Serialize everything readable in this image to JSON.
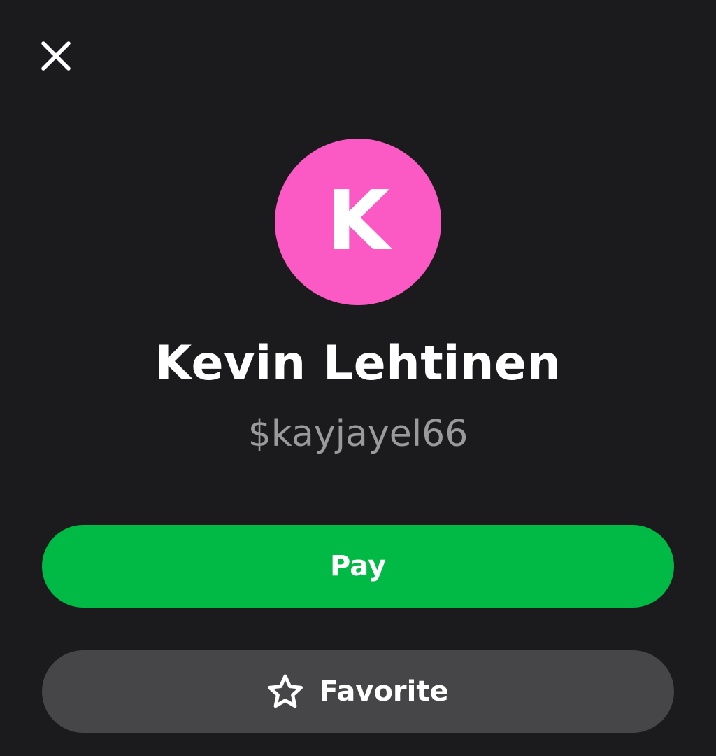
{
  "colors": {
    "background": "#1b1b1d",
    "avatar_bg": "#fb5ac4",
    "pay_bg": "#00ba45",
    "favorite_bg": "#464648",
    "handle_text": "#9a9a9c"
  },
  "header": {
    "close_icon": "close-icon"
  },
  "profile": {
    "initial": "K",
    "name": "Kevin Lehtinen",
    "handle": "$kayjayel66"
  },
  "actions": {
    "pay_label": "Pay",
    "favorite_label": "Favorite",
    "favorite_icon": "star-outline-icon"
  }
}
